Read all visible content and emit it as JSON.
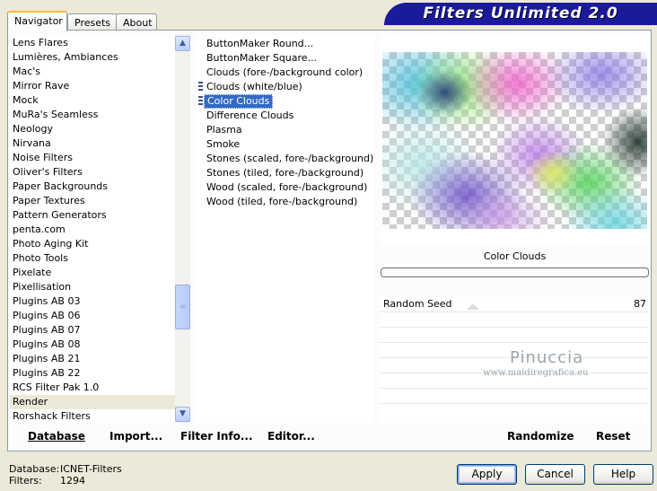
{
  "tabs": [
    {
      "label": "Navigator",
      "active": true
    },
    {
      "label": "Presets",
      "active": false
    },
    {
      "label": "About",
      "active": false
    }
  ],
  "banner": {
    "title": "Filters Unlimited 2.0"
  },
  "categories": [
    "Lens Flares",
    "Lumières, Ambiances",
    "Mac's",
    "Mirror Rave",
    "Mock",
    "MuRa's Seamless",
    "Neology",
    "Nirvana",
    "Noise Filters",
    "Oliver's Filters",
    "Paper Backgrounds",
    "Paper Textures",
    "Pattern Generators",
    "penta.com",
    "Photo Aging Kit",
    "Photo Tools",
    "Pixelate",
    "Pixellisation",
    "Plugins AB 03",
    "Plugins AB 06",
    "Plugins AB 07",
    "Plugins AB 08",
    "Plugins AB 21",
    "Plugins AB 22",
    "RCS Filter Pak 1.0",
    "Render",
    "Rorshack Filters"
  ],
  "selected_category": "Render",
  "scrollbar": {
    "up_icon": "▲",
    "down_icon": "▼",
    "grip_icon": "≡"
  },
  "filters": [
    "ButtonMaker Round...",
    "ButtonMaker Square...",
    "Clouds (fore-/background color)",
    "Clouds (white/blue)",
    "Color Clouds",
    "Difference Clouds",
    "Plasma",
    "Smoke",
    "Stones (scaled, fore-/background)",
    "Stones (tiled, fore-/background)",
    "Wood (scaled, fore-/background)",
    "Wood (tiled, fore-/background)"
  ],
  "selected_filter": "Color Clouds",
  "preview": {
    "filter_name": "Color Clouds"
  },
  "params": [
    {
      "label": "Random Seed",
      "value": "87"
    }
  ],
  "watermark": {
    "name": "Pinuccia",
    "url": "www.maidiregrafica.eu"
  },
  "commands": {
    "database": "Database",
    "import": "Import...",
    "filter_info": "Filter Info...",
    "editor": "Editor...",
    "randomize": "Randomize",
    "reset": "Reset"
  },
  "status": {
    "database_label": "Database:",
    "database_value": "ICNET-Filters",
    "filters_label": "Filters:",
    "filters_value": "1294"
  },
  "buttons": {
    "apply": "Apply",
    "cancel": "Cancel",
    "help": "Help"
  },
  "colors": {
    "banner": "#1a1a9a",
    "selection": "#316ac5",
    "active_tab": "#f9b93d"
  }
}
